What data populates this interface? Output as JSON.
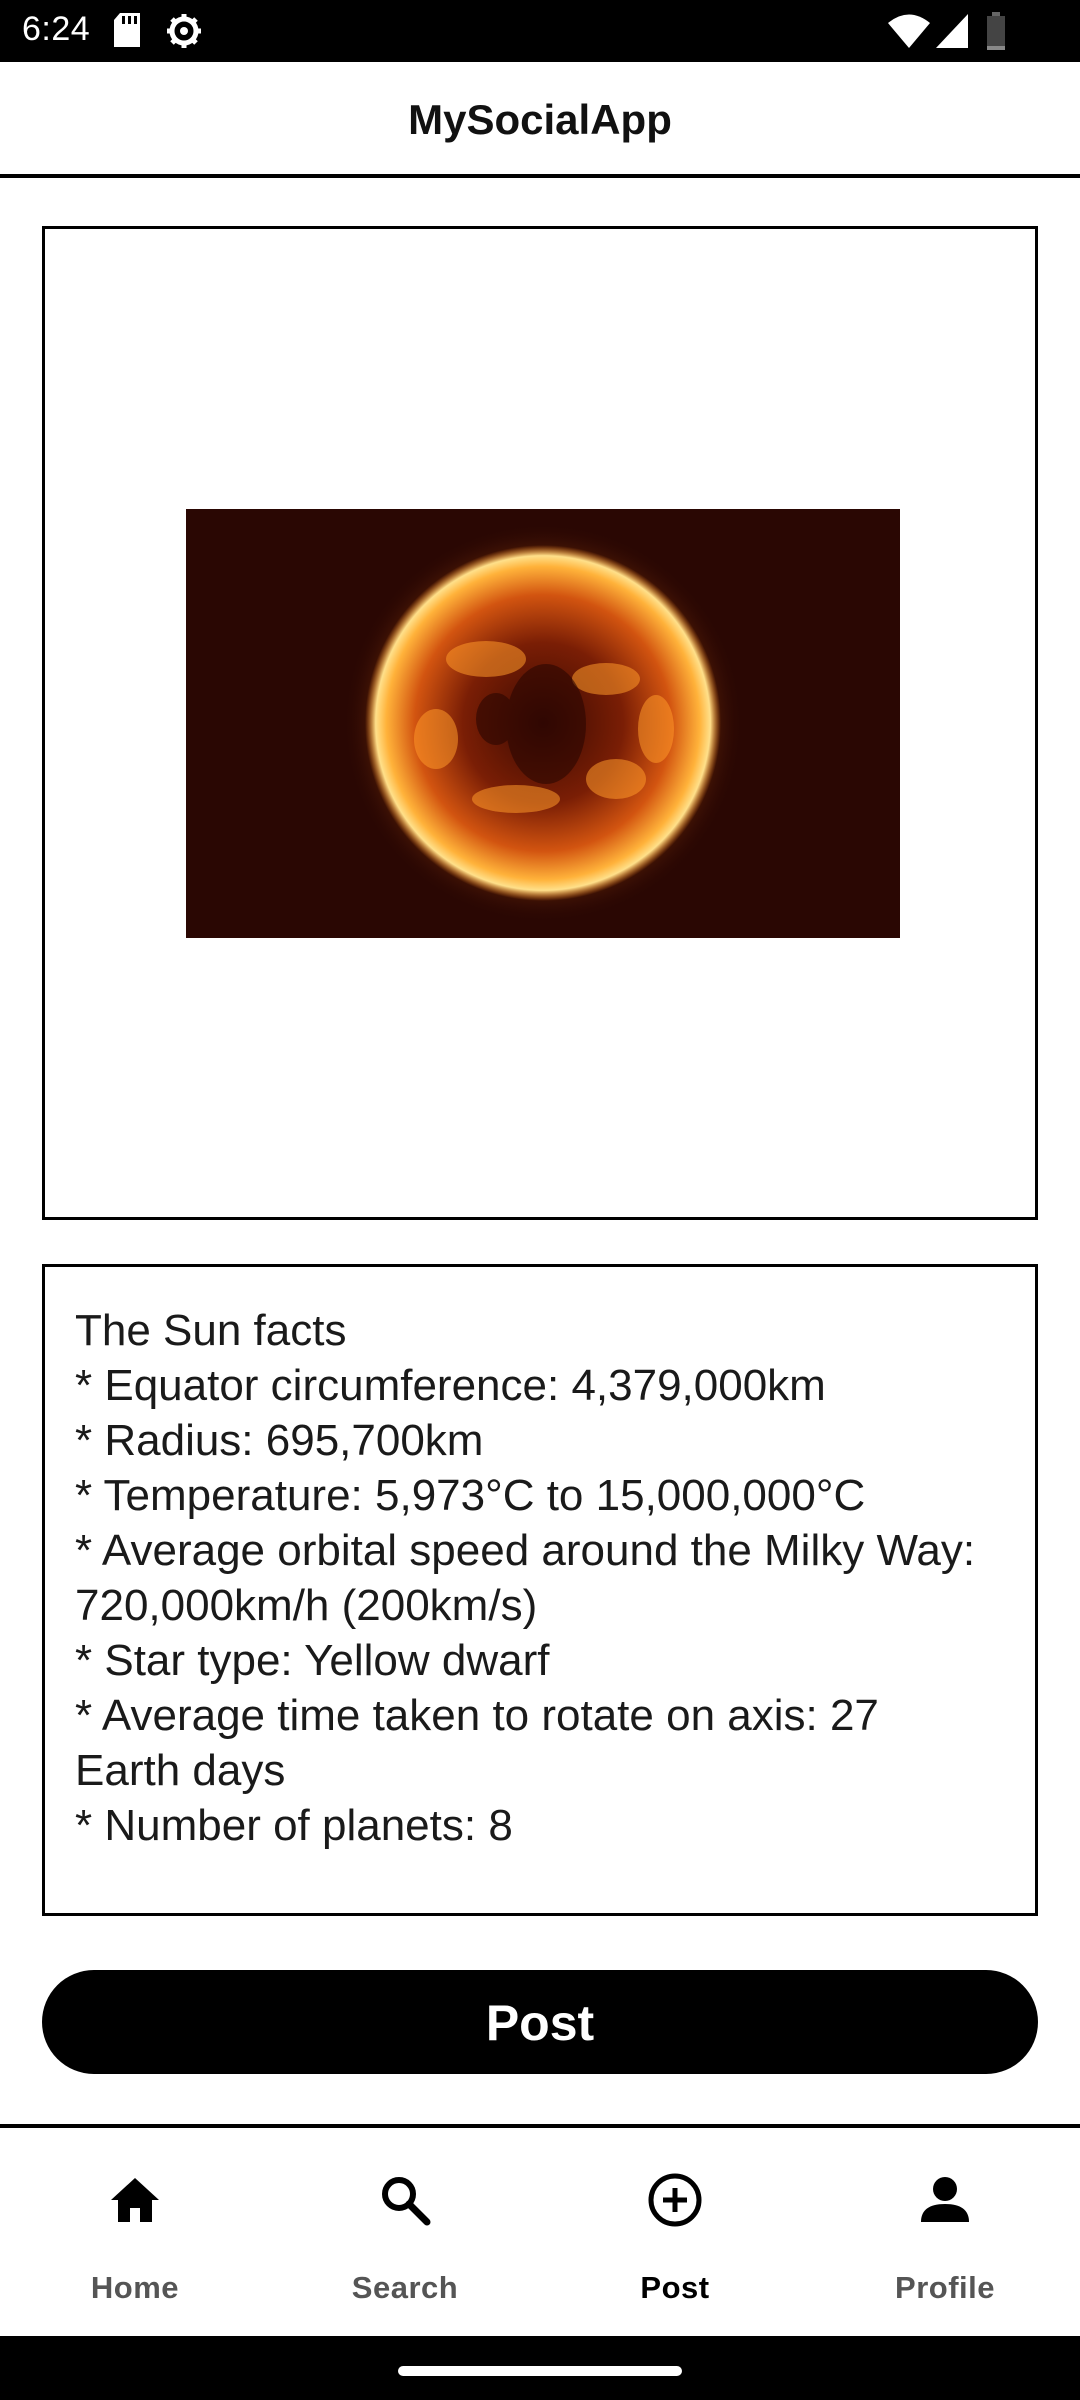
{
  "status_bar": {
    "time": "6:24",
    "icons": [
      "sd-card-icon",
      "settings-gear-icon",
      "wifi-icon",
      "signal-icon",
      "battery-icon"
    ]
  },
  "app_bar": {
    "title": "MySocialApp"
  },
  "post": {
    "image_alt": "sun-photo",
    "text": "The Sun facts\n* Equator circumference: 4,379,000km\n* Radius: 695,700km\n* Temperature: 5,973°C to 15,000,000°C\n* Average orbital speed around the Milky Way: 720,000km/h (200km/s)\n* Star type: Yellow dwarf\n* Average time taken to rotate on axis: 27 Earth days\n* Number of planets: 8",
    "button_label": "Post"
  },
  "bottom_nav": {
    "items": [
      {
        "label": "Home",
        "icon": "home-icon"
      },
      {
        "label": "Search",
        "icon": "search-icon"
      },
      {
        "label": "Post",
        "icon": "add-circle-icon",
        "active": true
      },
      {
        "label": "Profile",
        "icon": "person-icon"
      }
    ]
  },
  "colors": {
    "primary": "#000000",
    "background": "#ffffff",
    "inactive_label": "#555555"
  }
}
